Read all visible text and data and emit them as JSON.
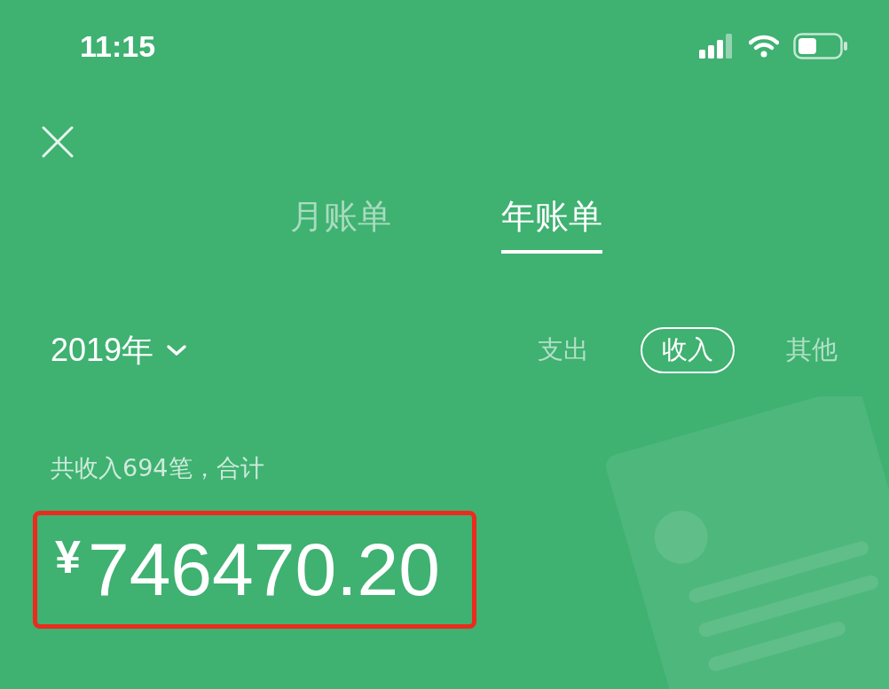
{
  "status_bar": {
    "time": "11:15"
  },
  "tabs": [
    {
      "label": "月账单",
      "selected": false
    },
    {
      "label": "年账单",
      "selected": true
    }
  ],
  "year_picker": {
    "label": "2019年"
  },
  "filters": [
    {
      "label": "支出",
      "selected": false
    },
    {
      "label": "收入",
      "selected": true
    },
    {
      "label": "其他",
      "selected": false
    }
  ],
  "summary": "共收入694笔，合计",
  "total": {
    "currency": "¥",
    "amount": "746470.20",
    "highlighted": true
  }
}
